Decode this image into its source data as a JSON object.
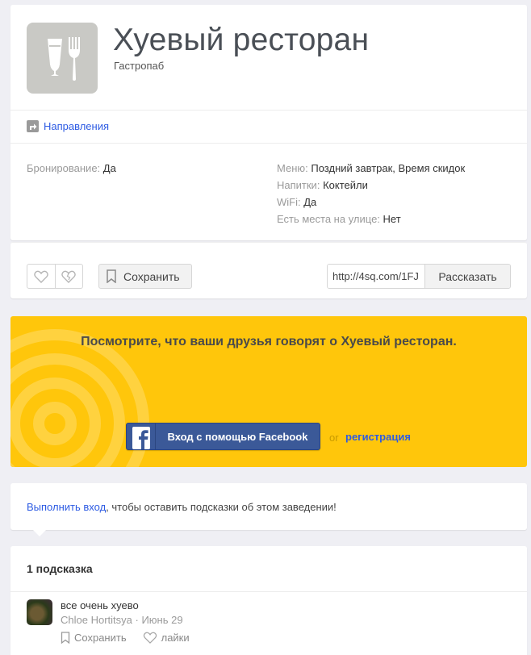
{
  "venue": {
    "name": "Хуевый ресторан",
    "category": "Гастропаб",
    "icon": "food-drink-icon"
  },
  "directions": {
    "label": "Направления",
    "icon": "directions-icon"
  },
  "attributes_left": [
    {
      "label": "Бронирование:",
      "value": "Да"
    }
  ],
  "attributes_right": [
    {
      "label": "Меню:",
      "value": "Поздний завтрак, Время скидок"
    },
    {
      "label": "Напитки:",
      "value": "Коктейли"
    },
    {
      "label": "WiFi:",
      "value": "Да"
    },
    {
      "label": "Есть места на улице:",
      "value": "Нет"
    }
  ],
  "actions": {
    "save_label": "Сохранить",
    "share_url": "http://4sq.com/1FJ",
    "share_label": "Рассказать"
  },
  "banner": {
    "text": "Посмотрите, что ваши друзья говорят о Хуевый ресторан.",
    "fb_login_label": "Вход с помощью Facebook",
    "or": "or",
    "register_label": "регистрация",
    "color": "#ffc60b"
  },
  "login_prompt": {
    "link": "Выполнить вход",
    "text": ", чтобы оставить подсказки об этом заведении!"
  },
  "tips": {
    "title": "1 подсказка",
    "items": [
      {
        "text": "все очень хуево",
        "author": "Chloe Hortitsya",
        "separator": " · ",
        "date": "Июнь 29",
        "save_label": "Сохранить",
        "like_label": "лайки"
      }
    ]
  },
  "colors": {
    "link": "#2d5be3",
    "facebook": "#3b5998",
    "background": "#efeff4"
  }
}
